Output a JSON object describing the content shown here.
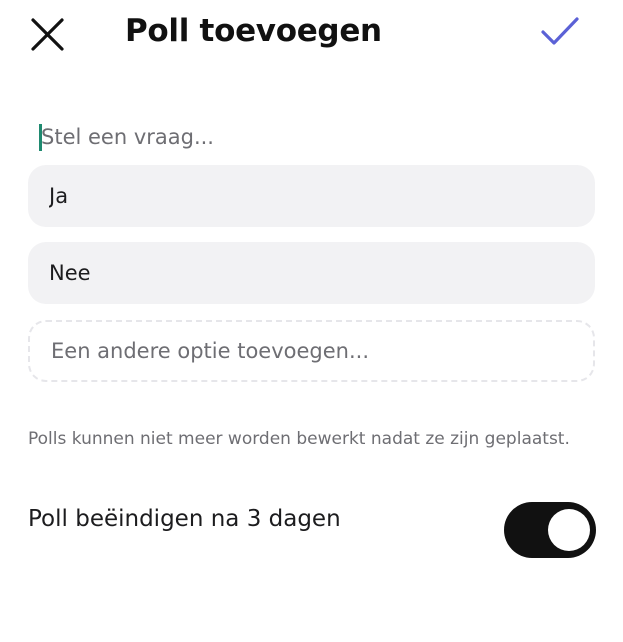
{
  "header": {
    "title": "Poll toevoegen",
    "close_icon": "close-icon",
    "confirm_icon": "checkmark-icon",
    "confirm_color": "#5b61d6"
  },
  "question": {
    "placeholder": "Stel een vraag...",
    "value": ""
  },
  "options": [
    {
      "value": "Ja"
    },
    {
      "value": "Nee"
    }
  ],
  "add_option": {
    "placeholder": "Een andere optie toevoegen..."
  },
  "notice": "Polls kunnen niet meer worden bewerkt nadat ze zijn geplaatst.",
  "end_poll": {
    "label": "Poll beëindigen na 3 dagen",
    "enabled": true,
    "toggle_color": "#111111"
  }
}
